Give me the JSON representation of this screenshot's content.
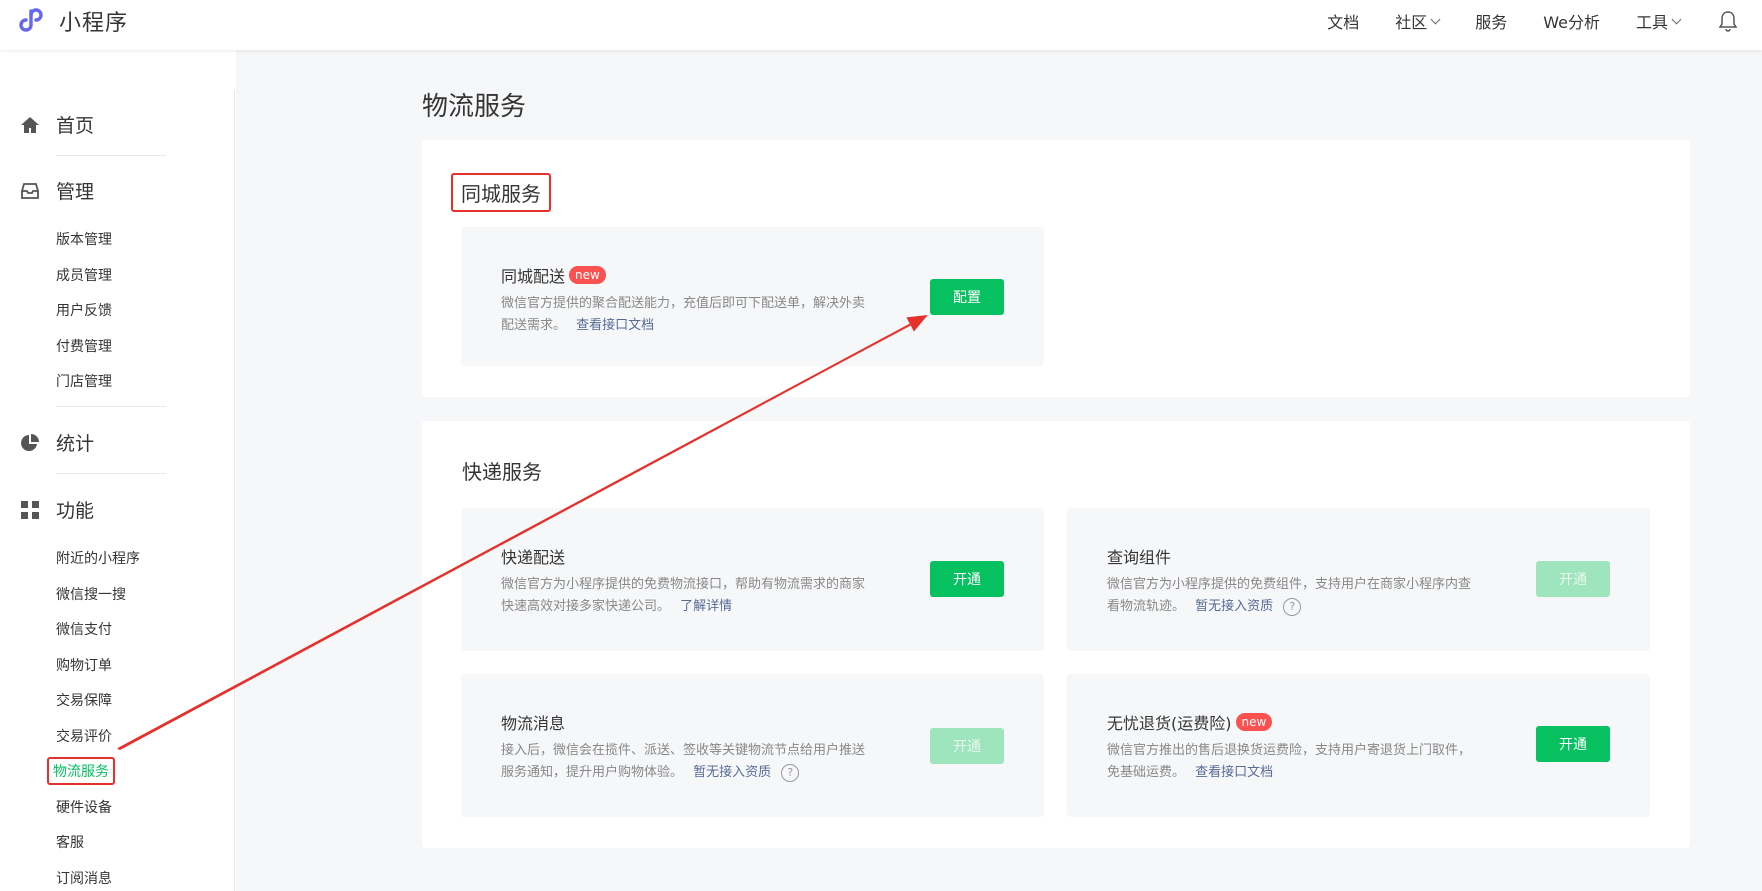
{
  "header": {
    "app_name": "小程序",
    "nav": [
      {
        "label": "文档",
        "has_dropdown": false
      },
      {
        "label": "社区",
        "has_dropdown": true
      },
      {
        "label": "服务",
        "has_dropdown": false
      },
      {
        "label": "We分析",
        "has_dropdown": false
      },
      {
        "label": "工具",
        "has_dropdown": true
      }
    ],
    "bell_icon": "bell-icon"
  },
  "sidebar": {
    "home": {
      "label": "首页",
      "icon": "home-icon"
    },
    "manage": {
      "label": "管理",
      "icon": "inbox-icon",
      "items": [
        "版本管理",
        "成员管理",
        "用户反馈",
        "付费管理",
        "门店管理"
      ]
    },
    "stats": {
      "label": "统计",
      "icon": "pie-chart-icon"
    },
    "features": {
      "label": "功能",
      "icon": "grid-icon",
      "items": [
        "附近的小程序",
        "微信搜一搜",
        "微信支付",
        "购物订单",
        "交易保障",
        "交易评价",
        "物流服务",
        "硬件设备",
        "客服",
        "订阅消息"
      ],
      "active_item": "物流服务"
    }
  },
  "main": {
    "page_title": "物流服务",
    "city_panel": {
      "title": "同城服务",
      "card": {
        "title": "同城配送",
        "badge": "new",
        "desc": "微信官方提供的聚合配送能力，充值后即可下配送单，解决外卖配送需求。",
        "link": "查看接口文档",
        "button": "配置"
      }
    },
    "express_panel": {
      "title": "快递服务",
      "cards": [
        {
          "title": "快递配送",
          "desc": "微信官方为小程序提供的免费物流接口，帮助有物流需求的商家快速高效对接多家快递公司。",
          "link": "了解详情",
          "button": "开通",
          "enabled": true
        },
        {
          "title": "查询组件",
          "desc": "微信官方为小程序提供的免费组件，支持用户在商家小程序内查看物流轨迹。",
          "link": "暂无接入资质",
          "button": "开通",
          "enabled": false,
          "help": "?"
        },
        {
          "title": "物流消息",
          "desc": "接入后，微信会在揽件、派送、签收等关键物流节点给用户推送服务通知，提升用户购物体验。",
          "link": "暂无接入资质",
          "button": "开通",
          "enabled": false,
          "help": "?"
        },
        {
          "title": "无忧退货(运费险)",
          "badge": "new",
          "desc": "微信官方推出的售后退换货运费险，支持用户寄退货上门取件，免基础运费。",
          "link": "查看接口文档",
          "button": "开通",
          "enabled": true
        }
      ]
    }
  },
  "colors": {
    "primary_green": "#07c160",
    "disabled_green": "#9ee5bd",
    "highlight_red": "#e5302b",
    "link_blue": "#576b95",
    "badge_red": "#fa5151"
  }
}
